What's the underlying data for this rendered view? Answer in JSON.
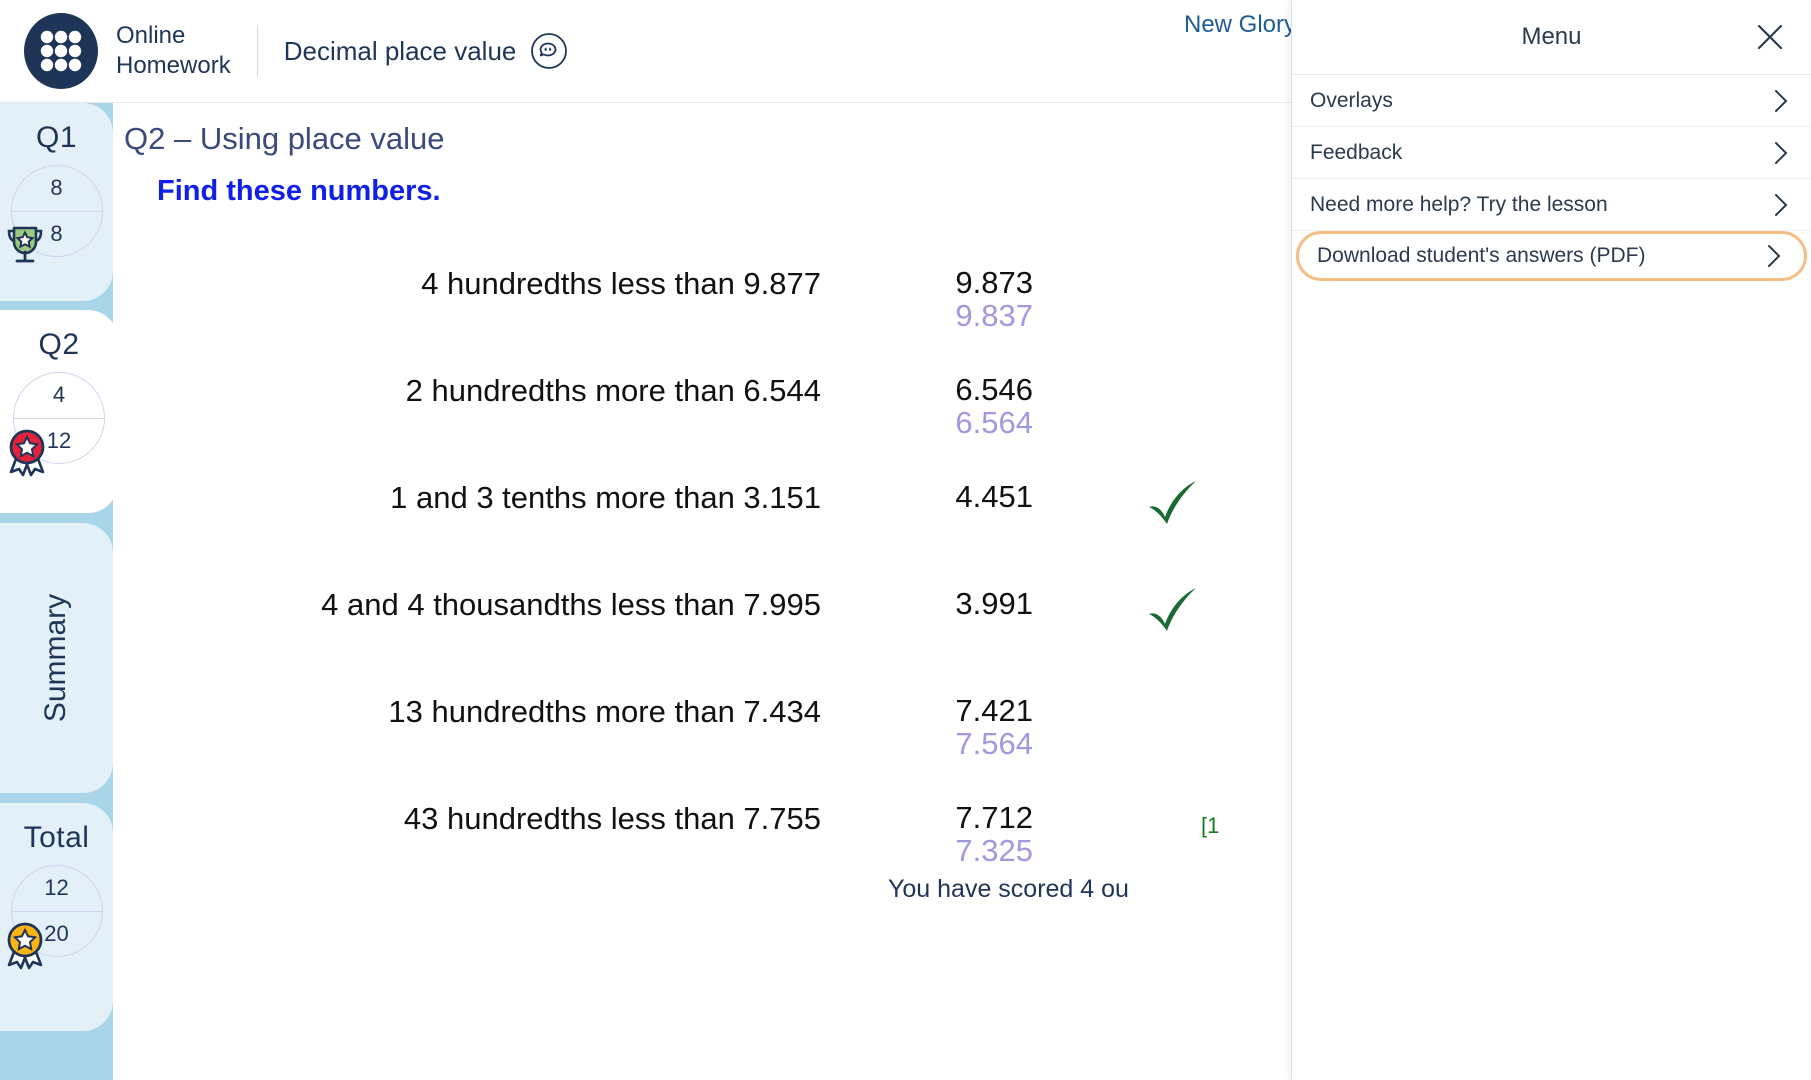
{
  "header": {
    "brand": "Online\nHomework",
    "activity_title": "Decimal place value",
    "help_icon": "speech-bubble-icon",
    "student_name": "New Glory"
  },
  "sidebar": {
    "tabs": [
      {
        "label": "Q1",
        "score": "8",
        "total": "8",
        "badge": "green-trophy-badge",
        "active": false
      },
      {
        "label": "Q2",
        "score": "4",
        "total": "12",
        "badge": "red-rosette-badge",
        "active": true
      }
    ],
    "summary_label": "Summary",
    "total": {
      "label": "Total",
      "score": "12",
      "total": "20",
      "badge": "gold-rosette-badge"
    }
  },
  "main": {
    "question_title": "Q2 – Using place value",
    "instruction": "Find these numbers.",
    "rows": [
      {
        "prompt": "4 hundredths less than 9.877",
        "given": "9.873",
        "correct": "9.837",
        "tick": false,
        "note": ""
      },
      {
        "prompt": "2 hundredths more than 6.544",
        "given": "6.546",
        "correct": "6.564",
        "tick": false,
        "note": ""
      },
      {
        "prompt": "1 and 3 tenths more than 3.151",
        "given": "4.451",
        "correct": "",
        "tick": true,
        "note": ""
      },
      {
        "prompt": "4 and 4 thousandths less than 7.995",
        "given": "3.991",
        "correct": "",
        "tick": true,
        "note": ""
      },
      {
        "prompt": "13 hundredths more than 7.434",
        "given": "7.421",
        "correct": "7.564",
        "tick": false,
        "note": ""
      },
      {
        "prompt": "43 hundredths less than 7.755",
        "given": "7.712",
        "correct": "7.325",
        "tick": false,
        "note": "[1"
      }
    ],
    "score_line": "You have scored 4 ou"
  },
  "menu": {
    "title": "Menu",
    "close_icon": "close-icon",
    "items": [
      {
        "label": "Overlays",
        "highlighted": false
      },
      {
        "label": "Feedback",
        "highlighted": false
      },
      {
        "label": "Need more help? Try the lesson",
        "highlighted": false
      },
      {
        "label": "Download student's answers (PDF)",
        "highlighted": true
      }
    ]
  },
  "colors": {
    "brand_navy": "#1f3557",
    "rail_blue": "#a8d5e8",
    "tab_pale": "#e3f0f7",
    "instruction_blue": "#1020e8",
    "correct_purple": "#9d9ade",
    "tick_green": "#1a6b33",
    "highlight_orange": "#f6bd84"
  }
}
